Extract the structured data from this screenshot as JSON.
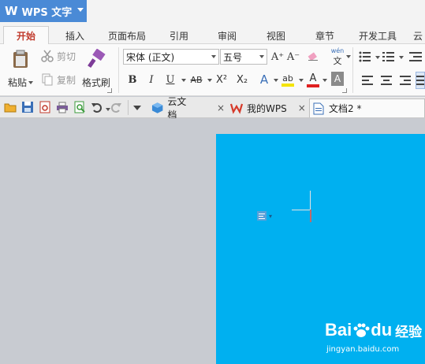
{
  "app": {
    "logo_glyph": "W",
    "title": "WPS 文字"
  },
  "tabs": [
    {
      "label": "开始",
      "active": true
    },
    {
      "label": "插入"
    },
    {
      "label": "页面布局"
    },
    {
      "label": "引用"
    },
    {
      "label": "审阅"
    },
    {
      "label": "视图"
    },
    {
      "label": "章节"
    },
    {
      "label": "开发工具"
    },
    {
      "label": "云"
    }
  ],
  "ribbon": {
    "clipboard": {
      "paste": "粘贴",
      "cut": "剪切",
      "copy": "复制",
      "format_painter": "格式刷"
    },
    "font": {
      "font_name": "宋体 (正文)",
      "font_size": "五号",
      "bold": "B",
      "italic": "I",
      "underline": "U",
      "strikethrough": "AB",
      "superscript": "X²",
      "subscript": "X₂",
      "text_effect": "A",
      "highlight": "ab",
      "font_color": "A",
      "char_shading": "A",
      "grow_font": "A⁺",
      "shrink_font": "A⁻",
      "phonetic": "wén",
      "phonetic_sub": "文"
    },
    "colors": {
      "highlight": "#f4e400",
      "font_color": "#e02020",
      "accent": "#4a8ad6"
    }
  },
  "doc_tabs": [
    {
      "label": "云文档",
      "icon": "cloud-doc-icon",
      "close": "×"
    },
    {
      "label": "我的WPS",
      "icon": "wps-logo-icon",
      "close": "×"
    },
    {
      "label": "文档2 *",
      "icon": "document-icon",
      "active": true
    }
  ],
  "document": {
    "page_color": "#00b0f0",
    "paste_options_glyph": "▾"
  },
  "watermark": {
    "brand": "Bai",
    "brand_suffix": "du",
    "service": "经验",
    "url": "jingyan.baidu.com"
  }
}
